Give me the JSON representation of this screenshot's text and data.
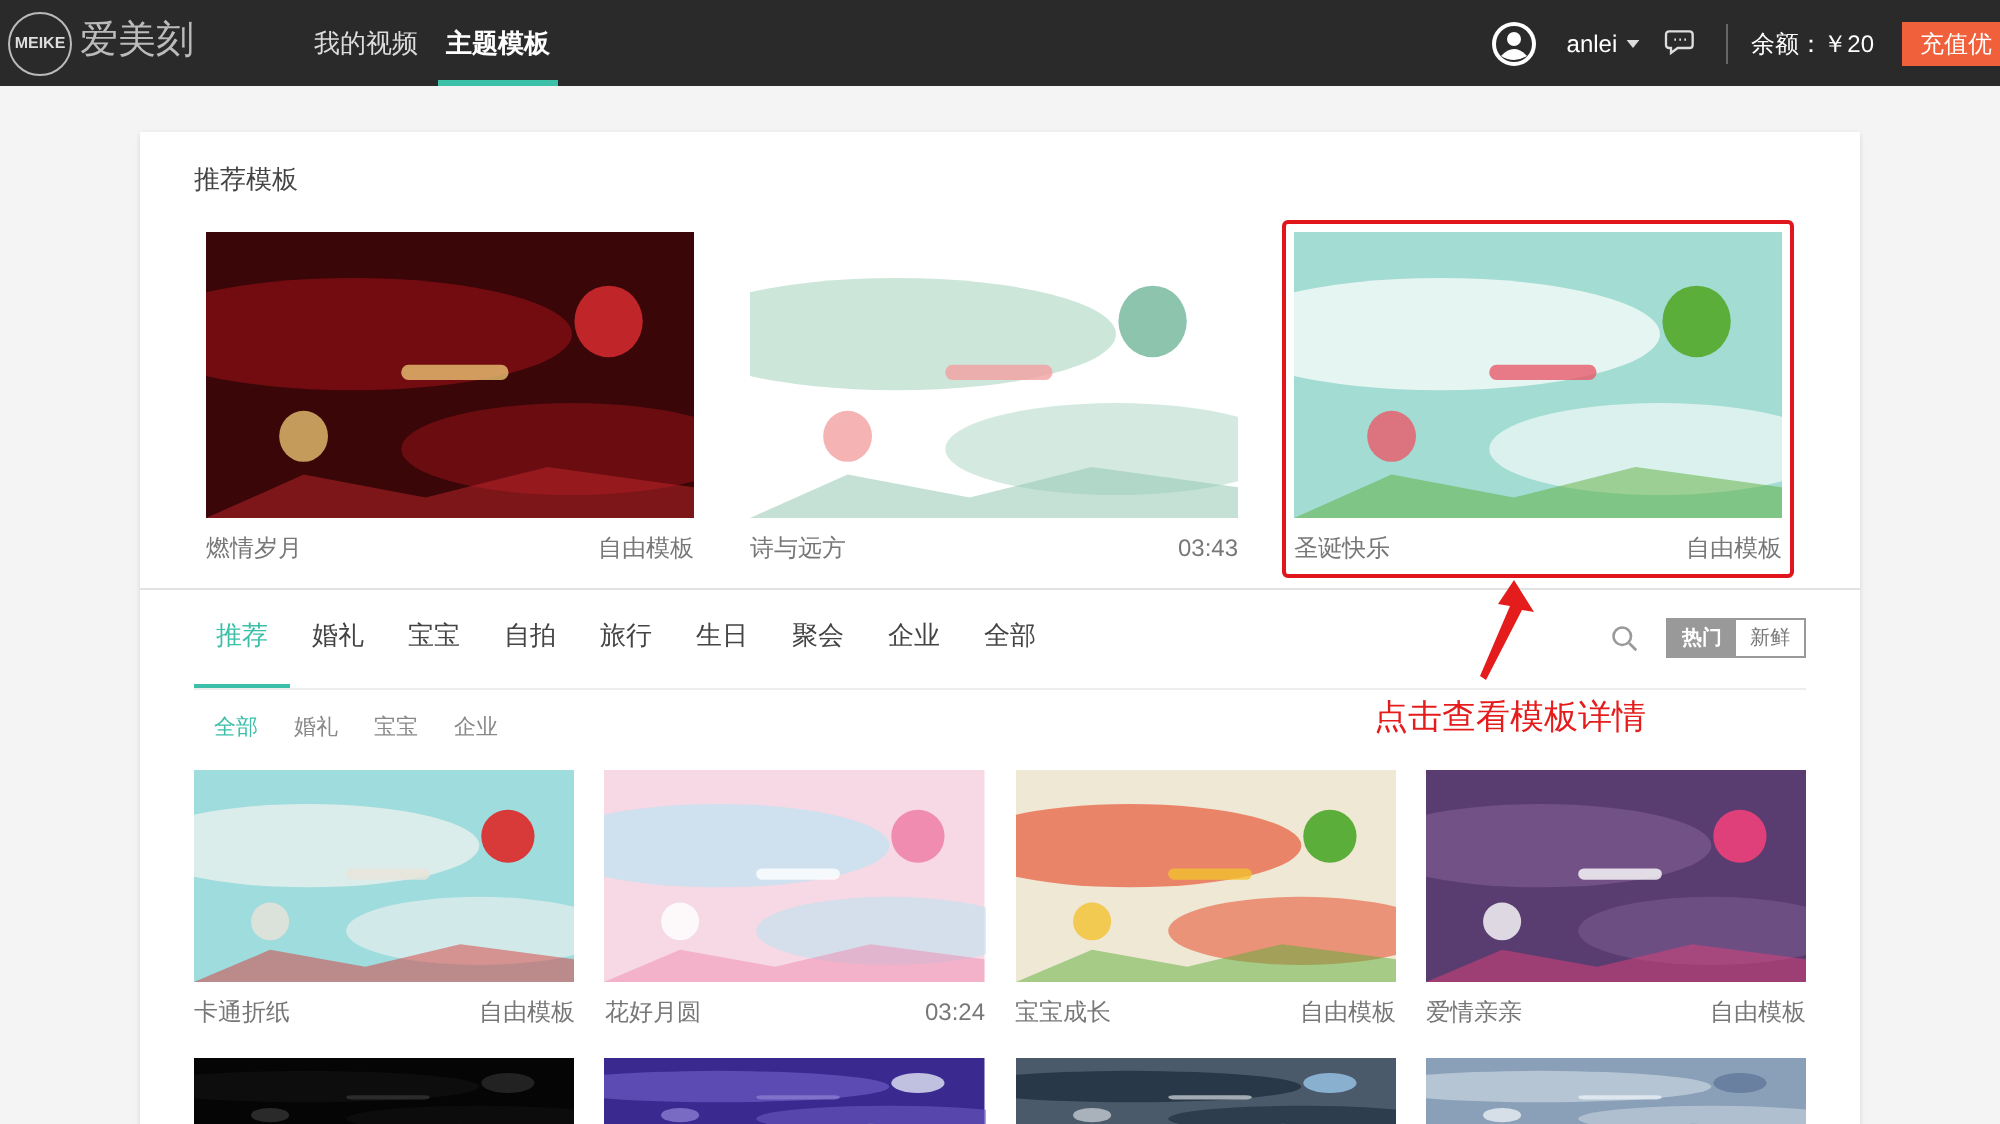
{
  "header": {
    "logo_mark": "MEIKE",
    "logo_text": "爱美刻",
    "nav": [
      {
        "label": "我的视频",
        "selected": false
      },
      {
        "label": "主题模板",
        "selected": true
      }
    ],
    "user": "anlei",
    "balance": "余额：￥20",
    "recharge_button": "充值优"
  },
  "recommended": {
    "title": "推荐模板",
    "items": [
      {
        "title": "燃情岁月",
        "meta": "自由模板",
        "highlighted": false
      },
      {
        "title": "诗与远方",
        "meta": "03:43",
        "highlighted": false
      },
      {
        "title": "圣诞快乐",
        "meta": "自由模板",
        "highlighted": true
      }
    ]
  },
  "categories": [
    {
      "label": "推荐",
      "selected": true
    },
    {
      "label": "婚礼",
      "selected": false
    },
    {
      "label": "宝宝",
      "selected": false
    },
    {
      "label": "自拍",
      "selected": false
    },
    {
      "label": "旅行",
      "selected": false
    },
    {
      "label": "生日",
      "selected": false
    },
    {
      "label": "聚会",
      "selected": false
    },
    {
      "label": "企业",
      "selected": false
    },
    {
      "label": "全部",
      "selected": false
    }
  ],
  "sort": [
    {
      "label": "热门",
      "selected": true
    },
    {
      "label": "新鲜",
      "selected": false
    }
  ],
  "filters": [
    {
      "label": "全部",
      "selected": true
    },
    {
      "label": "婚礼",
      "selected": false
    },
    {
      "label": "宝宝",
      "selected": false
    },
    {
      "label": "企业",
      "selected": false
    }
  ],
  "annotation": "点击查看模板详情",
  "templates": [
    {
      "kind": "template",
      "title": "卡通折纸",
      "meta": "自由模板"
    },
    {
      "kind": "template",
      "title": "花好月圆",
      "meta": "03:24"
    },
    {
      "kind": "template",
      "title": "宝宝成长",
      "meta": "自由模板"
    },
    {
      "kind": "template",
      "title": "爱情亲亲",
      "meta": "自由模板"
    },
    {
      "kind": "picture"
    },
    {
      "kind": "picture"
    },
    {
      "kind": "picture"
    },
    {
      "kind": "picture"
    }
  ]
}
